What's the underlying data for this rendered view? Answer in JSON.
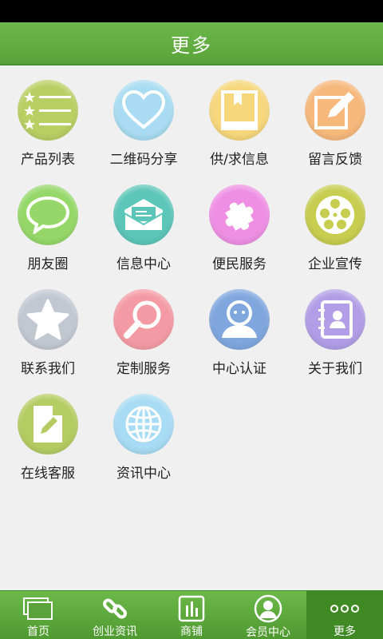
{
  "header": {
    "title": "更多"
  },
  "grid": {
    "items": [
      {
        "label": "产品列表",
        "icon": "product-list-icon",
        "color": "#b9cf63"
      },
      {
        "label": "二维码分享",
        "icon": "heart-icon",
        "color": "#a9dcf2"
      },
      {
        "label": "供/求信息",
        "icon": "book-icon",
        "color": "#f6d77c"
      },
      {
        "label": "留言反馈",
        "icon": "edit-icon",
        "color": "#f6b87b"
      },
      {
        "label": "朋友圈",
        "icon": "chat-bubble-icon",
        "color": "#95d869"
      },
      {
        "label": "信息中心",
        "icon": "envelope-icon",
        "color": "#5cc6b8"
      },
      {
        "label": "便民服务",
        "icon": "puzzle-icon",
        "color": "#ee8fe3"
      },
      {
        "label": "企业宣传",
        "icon": "film-reel-icon",
        "color": "#c6cd4f"
      },
      {
        "label": "联系我们",
        "icon": "star-icon",
        "color": "#c2c8d1"
      },
      {
        "label": "定制服务",
        "icon": "magnifier-icon",
        "color": "#f49aa4"
      },
      {
        "label": "中心认证",
        "icon": "user-icon",
        "color": "#7fa7de"
      },
      {
        "label": "关于我们",
        "icon": "contact-book-icon",
        "color": "#b19ee6"
      },
      {
        "label": "在线客服",
        "icon": "document-edit-icon",
        "color": "#b5cc62"
      },
      {
        "label": "资讯中心",
        "icon": "globe-icon",
        "color": "#a8dcf4"
      }
    ]
  },
  "tabbar": {
    "tabs": [
      {
        "label": "首页",
        "icon": "home-screens-icon"
      },
      {
        "label": "创业资讯",
        "icon": "link-icon"
      },
      {
        "label": "商铺",
        "icon": "bar-chart-icon"
      },
      {
        "label": "会员中心",
        "icon": "member-icon"
      },
      {
        "label": "更多",
        "icon": "more-dots-icon"
      }
    ],
    "active_tab": "更多"
  }
}
